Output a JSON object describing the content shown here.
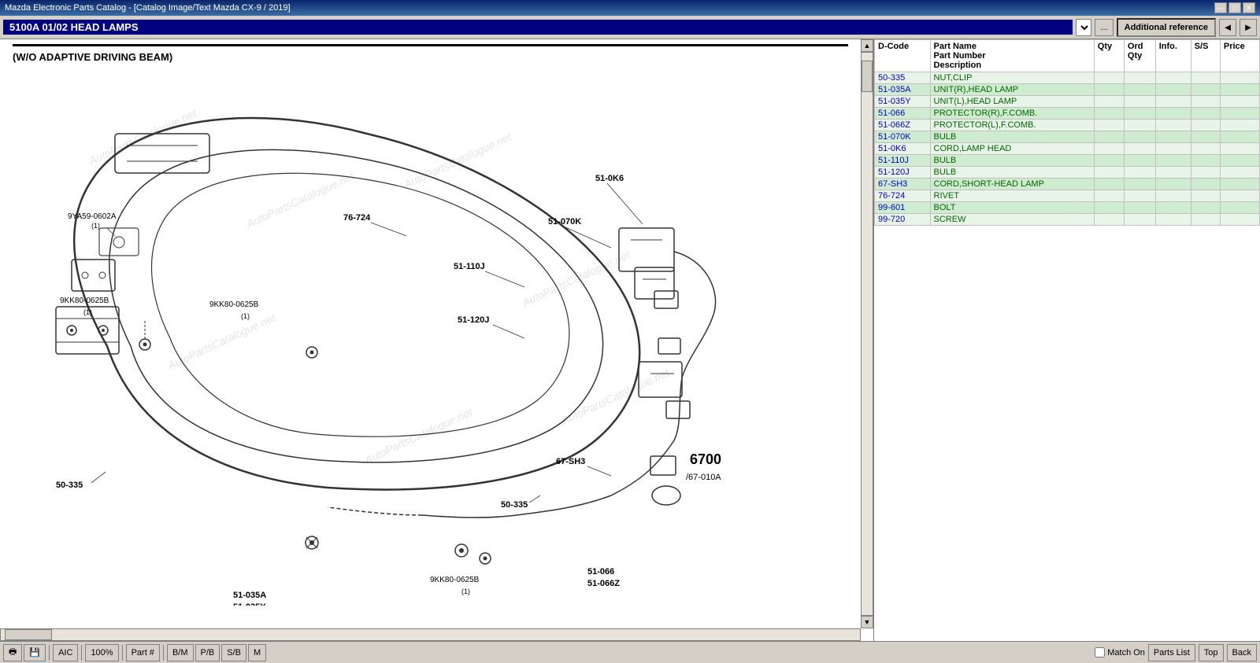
{
  "window": {
    "title": "Mazda Electronic Parts Catalog - [Catalog Image/Text Mazda CX-9 / 2019]",
    "min_btn": "—",
    "max_btn": "□",
    "close_btn": "✕"
  },
  "toolbar": {
    "section_label": "5100A 01/02 HEAD LAMPS",
    "additional_ref_label": "Additional reference",
    "nav_back": "◄",
    "nav_forward": "►",
    "ellipsis": "..."
  },
  "diagram": {
    "subtitle": "(W/O ADAPTIVE DRIVING BEAM)",
    "watermarks": [
      "AutoPartsCatalogue.net",
      "AutoPartsCatalogue.net",
      "AutoPartsCatalogue.net",
      "AutoPartsCatalogue.net",
      "AutoPartsCatalogue.net",
      "AutoPartsCatalogue.net"
    ]
  },
  "parts_table": {
    "headers": {
      "d_code": "D-Code",
      "part_name": "Part Name\nPart Number\nDescription",
      "qty": "Qty",
      "ord_qty": "Ord\nQty",
      "info": "Info.",
      "ss": "S/S",
      "price": "Price"
    },
    "rows": [
      {
        "d_code": "50-335",
        "part_name": "NUT,CLIP"
      },
      {
        "d_code": "51-035A",
        "part_name": "UNIT(R),HEAD LAMP"
      },
      {
        "d_code": "51-035Y",
        "part_name": "UNIT(L),HEAD LAMP"
      },
      {
        "d_code": "51-066",
        "part_name": "PROTECTOR(R),F.COMB."
      },
      {
        "d_code": "51-066Z",
        "part_name": "PROTECTOR(L),F.COMB."
      },
      {
        "d_code": "51-070K",
        "part_name": "BULB"
      },
      {
        "d_code": "51-0K6",
        "part_name": "CORD,LAMP HEAD"
      },
      {
        "d_code": "51-110J",
        "part_name": "BULB"
      },
      {
        "d_code": "51-120J",
        "part_name": "BULB"
      },
      {
        "d_code": "67-SH3",
        "part_name": "CORD,SHORT-HEAD LAMP"
      },
      {
        "d_code": "76-724",
        "part_name": "RIVET"
      },
      {
        "d_code": "99-601",
        "part_name": "BOLT"
      },
      {
        "d_code": "99-720",
        "part_name": "SCREW"
      }
    ]
  },
  "status_bar": {
    "print_icon": "🖶",
    "save_icon": "💾",
    "aic_label": "AIC",
    "zoom_label": "100%",
    "part_label": "Part #",
    "bm_label": "B/M",
    "pb_label": "P/B",
    "sb_label": "S/B",
    "m_label": "M",
    "match_on_label": "Match On",
    "parts_list_label": "Parts List",
    "top_label": "Top",
    "back_label": "Back"
  }
}
